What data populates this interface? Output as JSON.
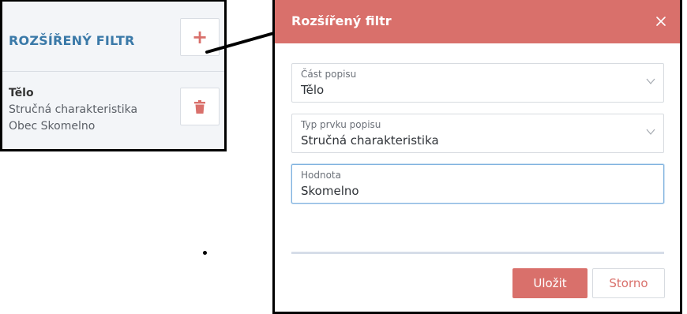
{
  "left_panel": {
    "title": "ROZŠÍŘENÝ FILTR",
    "add_icon": "plus-icon",
    "entry": {
      "line1": "Tělo",
      "line2": "Stručná charakteristika",
      "line3": "Obec Skomelno"
    },
    "delete_icon": "trash-icon"
  },
  "dialog": {
    "title": "Rozšířený filtr",
    "close_icon": "close-icon",
    "fields": [
      {
        "label": "Část popisu",
        "value": "Tělo",
        "type": "select"
      },
      {
        "label": "Typ prvku popisu",
        "value": "Stručná charakteristika",
        "type": "select"
      },
      {
        "label": "Hodnota",
        "value": "Skomelno",
        "type": "text"
      }
    ],
    "save_label": "Uložit",
    "cancel_label": "Storno"
  },
  "colors": {
    "accent": "#d9706b",
    "title_blue": "#3a79a8",
    "focus_border": "#7fb2df"
  }
}
